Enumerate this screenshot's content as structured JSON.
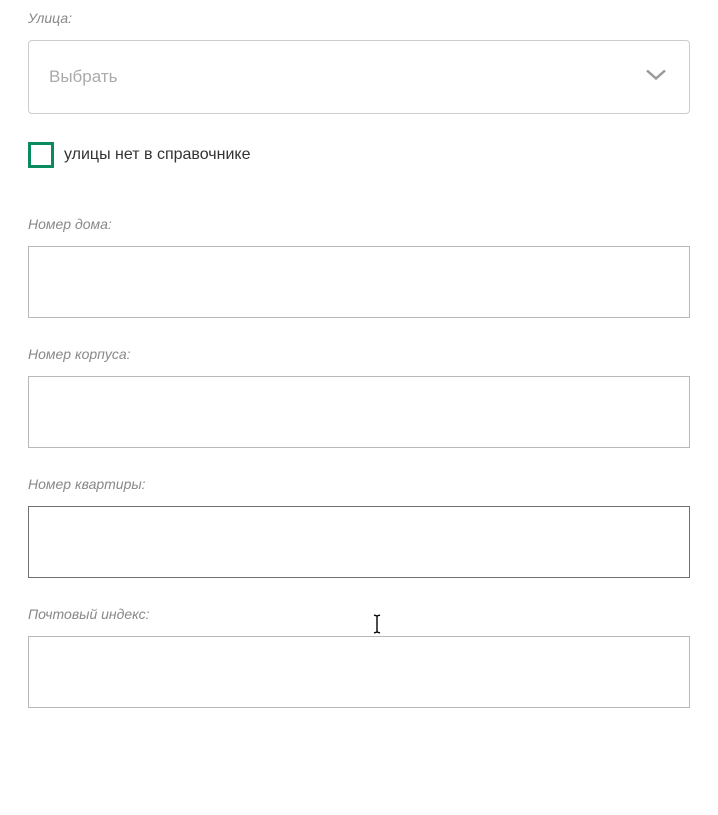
{
  "fields": {
    "street": {
      "label": "Улица:",
      "placeholder": "Выбрать"
    },
    "noStreetCheckbox": {
      "label": "улицы нет в справочнике"
    },
    "houseNumber": {
      "label": "Номер дома:"
    },
    "buildingNumber": {
      "label": "Номер корпуса:"
    },
    "apartmentNumber": {
      "label": "Номер квартиры:"
    },
    "postalCode": {
      "label": "Почтовый индекс:"
    }
  }
}
